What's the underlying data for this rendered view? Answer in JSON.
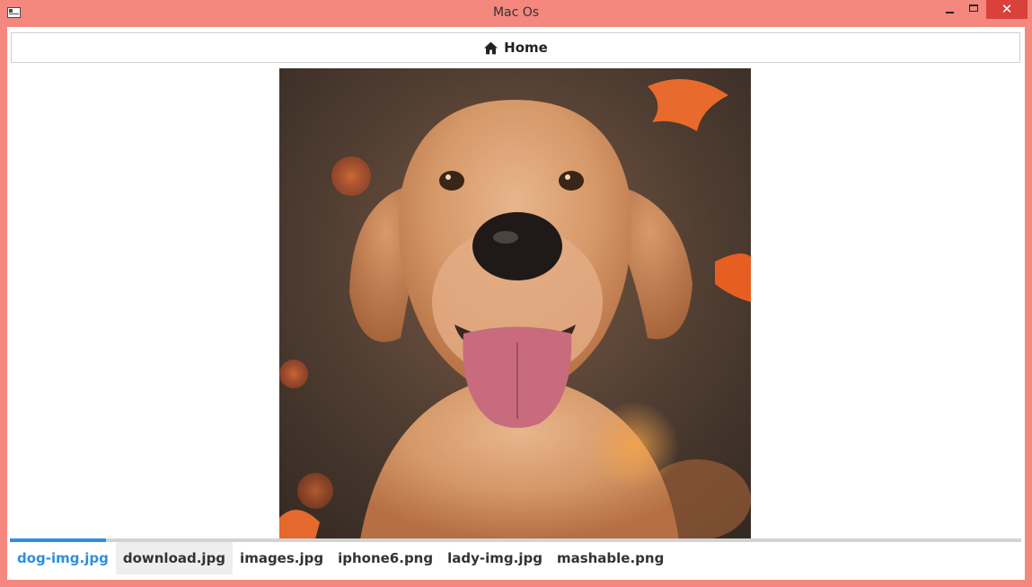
{
  "window": {
    "title": "Mac Os",
    "close_glyph": "✕"
  },
  "nav": {
    "home_label": "Home",
    "icon": "home-icon"
  },
  "image": {
    "subject": "dog-photo"
  },
  "tabs": [
    {
      "label": "dog-img.jpg",
      "active": true
    },
    {
      "label": "download.jpg",
      "active": false
    },
    {
      "label": "images.jpg",
      "active": false
    },
    {
      "label": "iphone6.png",
      "active": false
    },
    {
      "label": "lady-img.jpg",
      "active": false
    },
    {
      "label": "mashable.png",
      "active": false
    }
  ],
  "colors": {
    "accent": "#2c8fe0",
    "frame": "#f4877e",
    "close": "#d9413a"
  }
}
